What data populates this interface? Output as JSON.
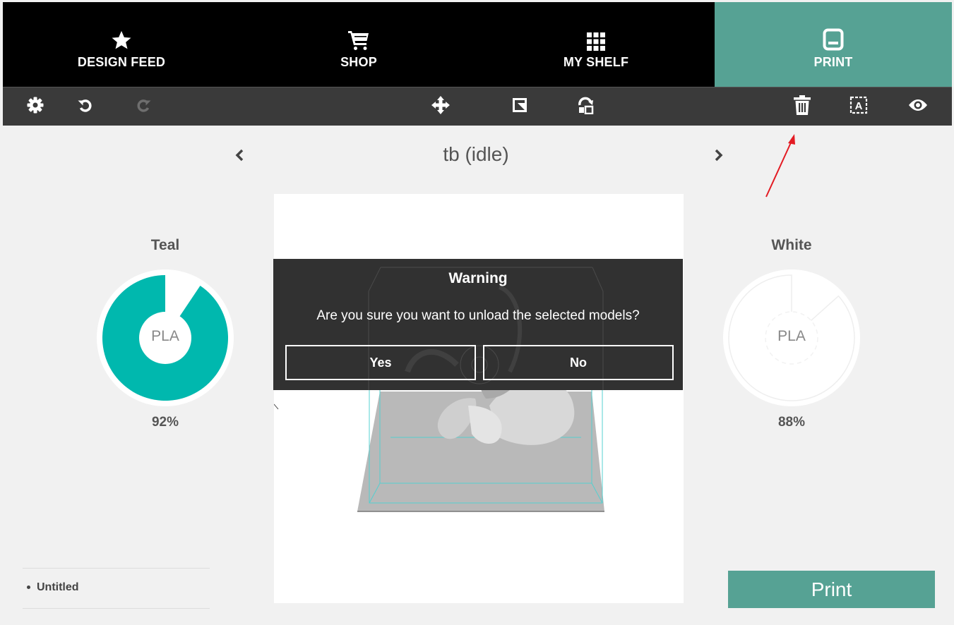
{
  "nav": {
    "tabs": [
      {
        "label": "DESIGN FEED",
        "icon": "star-icon"
      },
      {
        "label": "SHOP",
        "icon": "cart-icon"
      },
      {
        "label": "MY SHELF",
        "icon": "grid-icon"
      },
      {
        "label": "PRINT",
        "icon": "printer-icon",
        "active": true
      }
    ]
  },
  "toolbar": {
    "left": [
      "gear-icon",
      "undo-icon",
      "redo-icon"
    ],
    "center": [
      "move-icon",
      "scale-icon",
      "rotate-icon"
    ],
    "right": [
      "trash-icon",
      "text-icon",
      "eye-icon"
    ]
  },
  "printer": {
    "name": "tb (idle)"
  },
  "materials": {
    "left": {
      "name": "Teal",
      "type": "PLA",
      "percent": "92%",
      "fill_fraction": 0.92,
      "color": "#00b8ae"
    },
    "right": {
      "name": "White",
      "type": "PLA",
      "percent": "88%",
      "fill_fraction": 0.88,
      "color": "#ffffff"
    }
  },
  "dialog": {
    "title": "Warning",
    "message": "Are you sure you want to unload the selected models?",
    "yes_label": "Yes",
    "no_label": "No"
  },
  "jobs": [
    "Untitled"
  ],
  "print_button": {
    "label": "Print"
  },
  "colors": {
    "accent": "#56a294",
    "filament": "#00b8ae",
    "annotation": "#e31b23"
  }
}
